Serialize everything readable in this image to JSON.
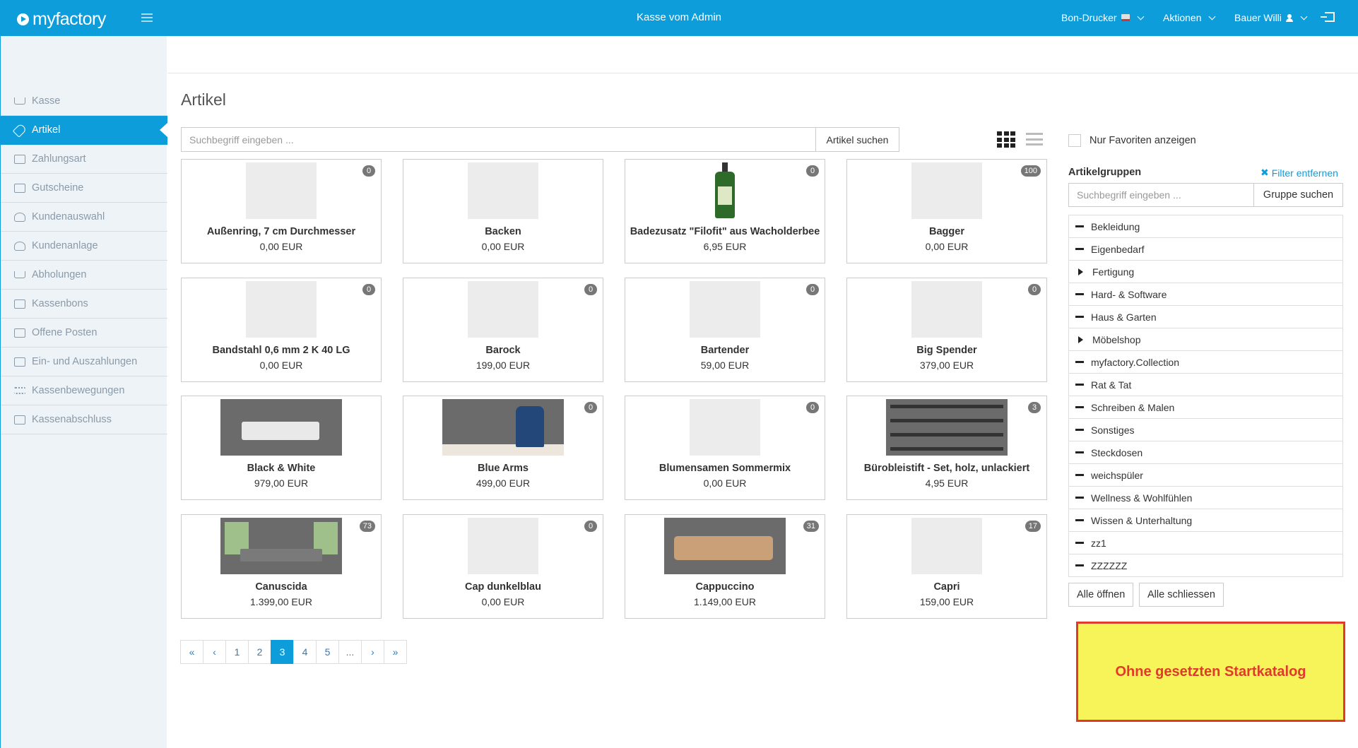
{
  "header": {
    "logo_text": "myfactory",
    "title": "Kasse vom Admin",
    "printer_label": "Bon-Drucker",
    "actions_label": "Aktionen",
    "user_label": "Bauer Willi"
  },
  "sidebar": {
    "items": [
      {
        "label": "Kasse",
        "icon": "cart-icon"
      },
      {
        "label": "Artikel",
        "icon": "tag-icon",
        "active": true
      },
      {
        "label": "Zahlungsart",
        "icon": "card-icon"
      },
      {
        "label": "Gutscheine",
        "icon": "gift-icon"
      },
      {
        "label": "Kundenauswahl",
        "icon": "user-icon"
      },
      {
        "label": "Kundenanlage",
        "icon": "user-add-icon"
      },
      {
        "label": "Abholungen",
        "icon": "cart-icon"
      },
      {
        "label": "Kassenbons",
        "icon": "receipt-icon"
      },
      {
        "label": "Offene Posten",
        "icon": "book-icon"
      },
      {
        "label": "Ein- und Auszahlungen",
        "icon": "inbox-icon"
      },
      {
        "label": "Kassenbewegungen",
        "icon": "list-icon"
      },
      {
        "label": "Kassenabschluss",
        "icon": "table-icon"
      }
    ]
  },
  "main": {
    "title": "Artikel",
    "search_placeholder": "Suchbegriff eingeben ...",
    "search_button": "Artikel suchen",
    "products": [
      {
        "name": "Außenring, 7 cm Durchmesser",
        "price": "0,00 EUR",
        "badge": "0",
        "image": "placeholder"
      },
      {
        "name": "Backen",
        "price": "0,00 EUR",
        "badge": "",
        "image": "placeholder"
      },
      {
        "name": "Badezusatz \"Filofit\" aus Wacholderbee",
        "price": "6,95 EUR",
        "badge": "0",
        "image": "bottle"
      },
      {
        "name": "Bagger",
        "price": "0,00 EUR",
        "badge": "100",
        "image": "placeholder"
      },
      {
        "name": "Bandstahl 0,6 mm 2 K 40 LG",
        "price": "0,00 EUR",
        "badge": "0",
        "image": "placeholder"
      },
      {
        "name": "Barock",
        "price": "199,00 EUR",
        "badge": "0",
        "image": "placeholder"
      },
      {
        "name": "Bartender",
        "price": "59,00 EUR",
        "badge": "0",
        "image": "placeholder"
      },
      {
        "name": "Big Spender",
        "price": "379,00 EUR",
        "badge": "0",
        "image": "placeholder"
      },
      {
        "name": "Black & White",
        "price": "979,00 EUR",
        "badge": "",
        "image": "sofa-photo"
      },
      {
        "name": "Blue Arms",
        "price": "499,00 EUR",
        "badge": "0",
        "image": "armchair-photo"
      },
      {
        "name": "Blumensamen Sommermix",
        "price": "0,00 EUR",
        "badge": "0",
        "image": "placeholder"
      },
      {
        "name": "Bürobleistift - Set, holz, unlackiert",
        "price": "4,95 EUR",
        "badge": "3",
        "image": "pencils-photo"
      },
      {
        "name": "Canuscida",
        "price": "1.399,00 EUR",
        "badge": "73",
        "image": "livingroom-photo"
      },
      {
        "name": "Cap dunkelblau",
        "price": "0,00 EUR",
        "badge": "0",
        "image": "placeholder"
      },
      {
        "name": "Cappuccino",
        "price": "1.149,00 EUR",
        "badge": "31",
        "image": "couch-photo"
      },
      {
        "name": "Capri",
        "price": "159,00 EUR",
        "badge": "17",
        "image": "placeholder"
      }
    ],
    "pagination": {
      "items": [
        "«",
        "‹",
        "1",
        "2",
        "3",
        "4",
        "5",
        "...",
        "›",
        "»"
      ],
      "current": "3"
    }
  },
  "right_panel": {
    "favorites_label": "Nur Favoriten anzeigen",
    "groups_title": "Artikelgruppen",
    "filter_remove": "Filter entfernen",
    "group_search_placeholder": "Suchbegriff eingeben ...",
    "group_search_button": "Gruppe suchen",
    "groups": [
      {
        "label": "Bekleidung",
        "type": "leaf"
      },
      {
        "label": "Eigenbedarf",
        "type": "leaf"
      },
      {
        "label": "Fertigung",
        "type": "collapsed"
      },
      {
        "label": "Hard- & Software",
        "type": "leaf"
      },
      {
        "label": "Haus & Garten",
        "type": "leaf"
      },
      {
        "label": "Möbelshop",
        "type": "collapsed"
      },
      {
        "label": "myfactory.Collection",
        "type": "leaf"
      },
      {
        "label": "Rat & Tat",
        "type": "leaf"
      },
      {
        "label": "Schreiben & Malen",
        "type": "leaf"
      },
      {
        "label": "Sonstiges",
        "type": "leaf"
      },
      {
        "label": "Steckdosen",
        "type": "leaf"
      },
      {
        "label": "weichspüler",
        "type": "leaf"
      },
      {
        "label": "Wellness & Wohlfühlen",
        "type": "leaf"
      },
      {
        "label": "Wissen & Unterhaltung",
        "type": "leaf"
      },
      {
        "label": "zz1",
        "type": "leaf"
      },
      {
        "label": "ZZZZZZ",
        "type": "leaf"
      }
    ],
    "open_all": "Alle öffnen",
    "close_all": "Alle schliessen"
  },
  "annotation": {
    "text": "Ohne gesetzten Startkatalog"
  },
  "colors": {
    "accent": "#0d9ddb",
    "sidebar_bg": "#eef3f7",
    "note_bg": "#f7f45a",
    "note_border": "#e03a2a"
  }
}
